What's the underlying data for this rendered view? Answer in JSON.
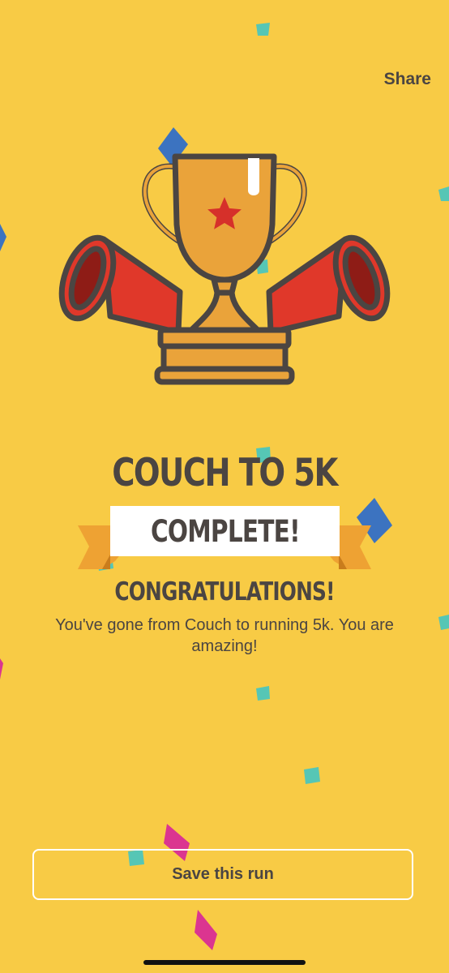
{
  "header": {
    "share_label": "Share"
  },
  "main": {
    "headline": "COUCH TO 5K",
    "ribbon_text": "COMPLETE!",
    "congrats": "CONGRATULATIONS!",
    "message": "You've gone from Couch to running 5k. You are amazing!"
  },
  "footer": {
    "save_label": "Save this run"
  },
  "illustration": {
    "icon": "trophy-with-megaphones-icon"
  },
  "colors": {
    "background": "#f8cb45",
    "text": "#4b4542",
    "trophy": "#eaa33a",
    "megaphone": "#e0382a",
    "megaphone_inner": "#8e1c16",
    "star": "#d6302a",
    "ribbon_tail": "#eea233",
    "confetti_blue": "#3c73c0",
    "confetti_teal": "#56c6b5",
    "confetti_pink": "#db3590"
  }
}
